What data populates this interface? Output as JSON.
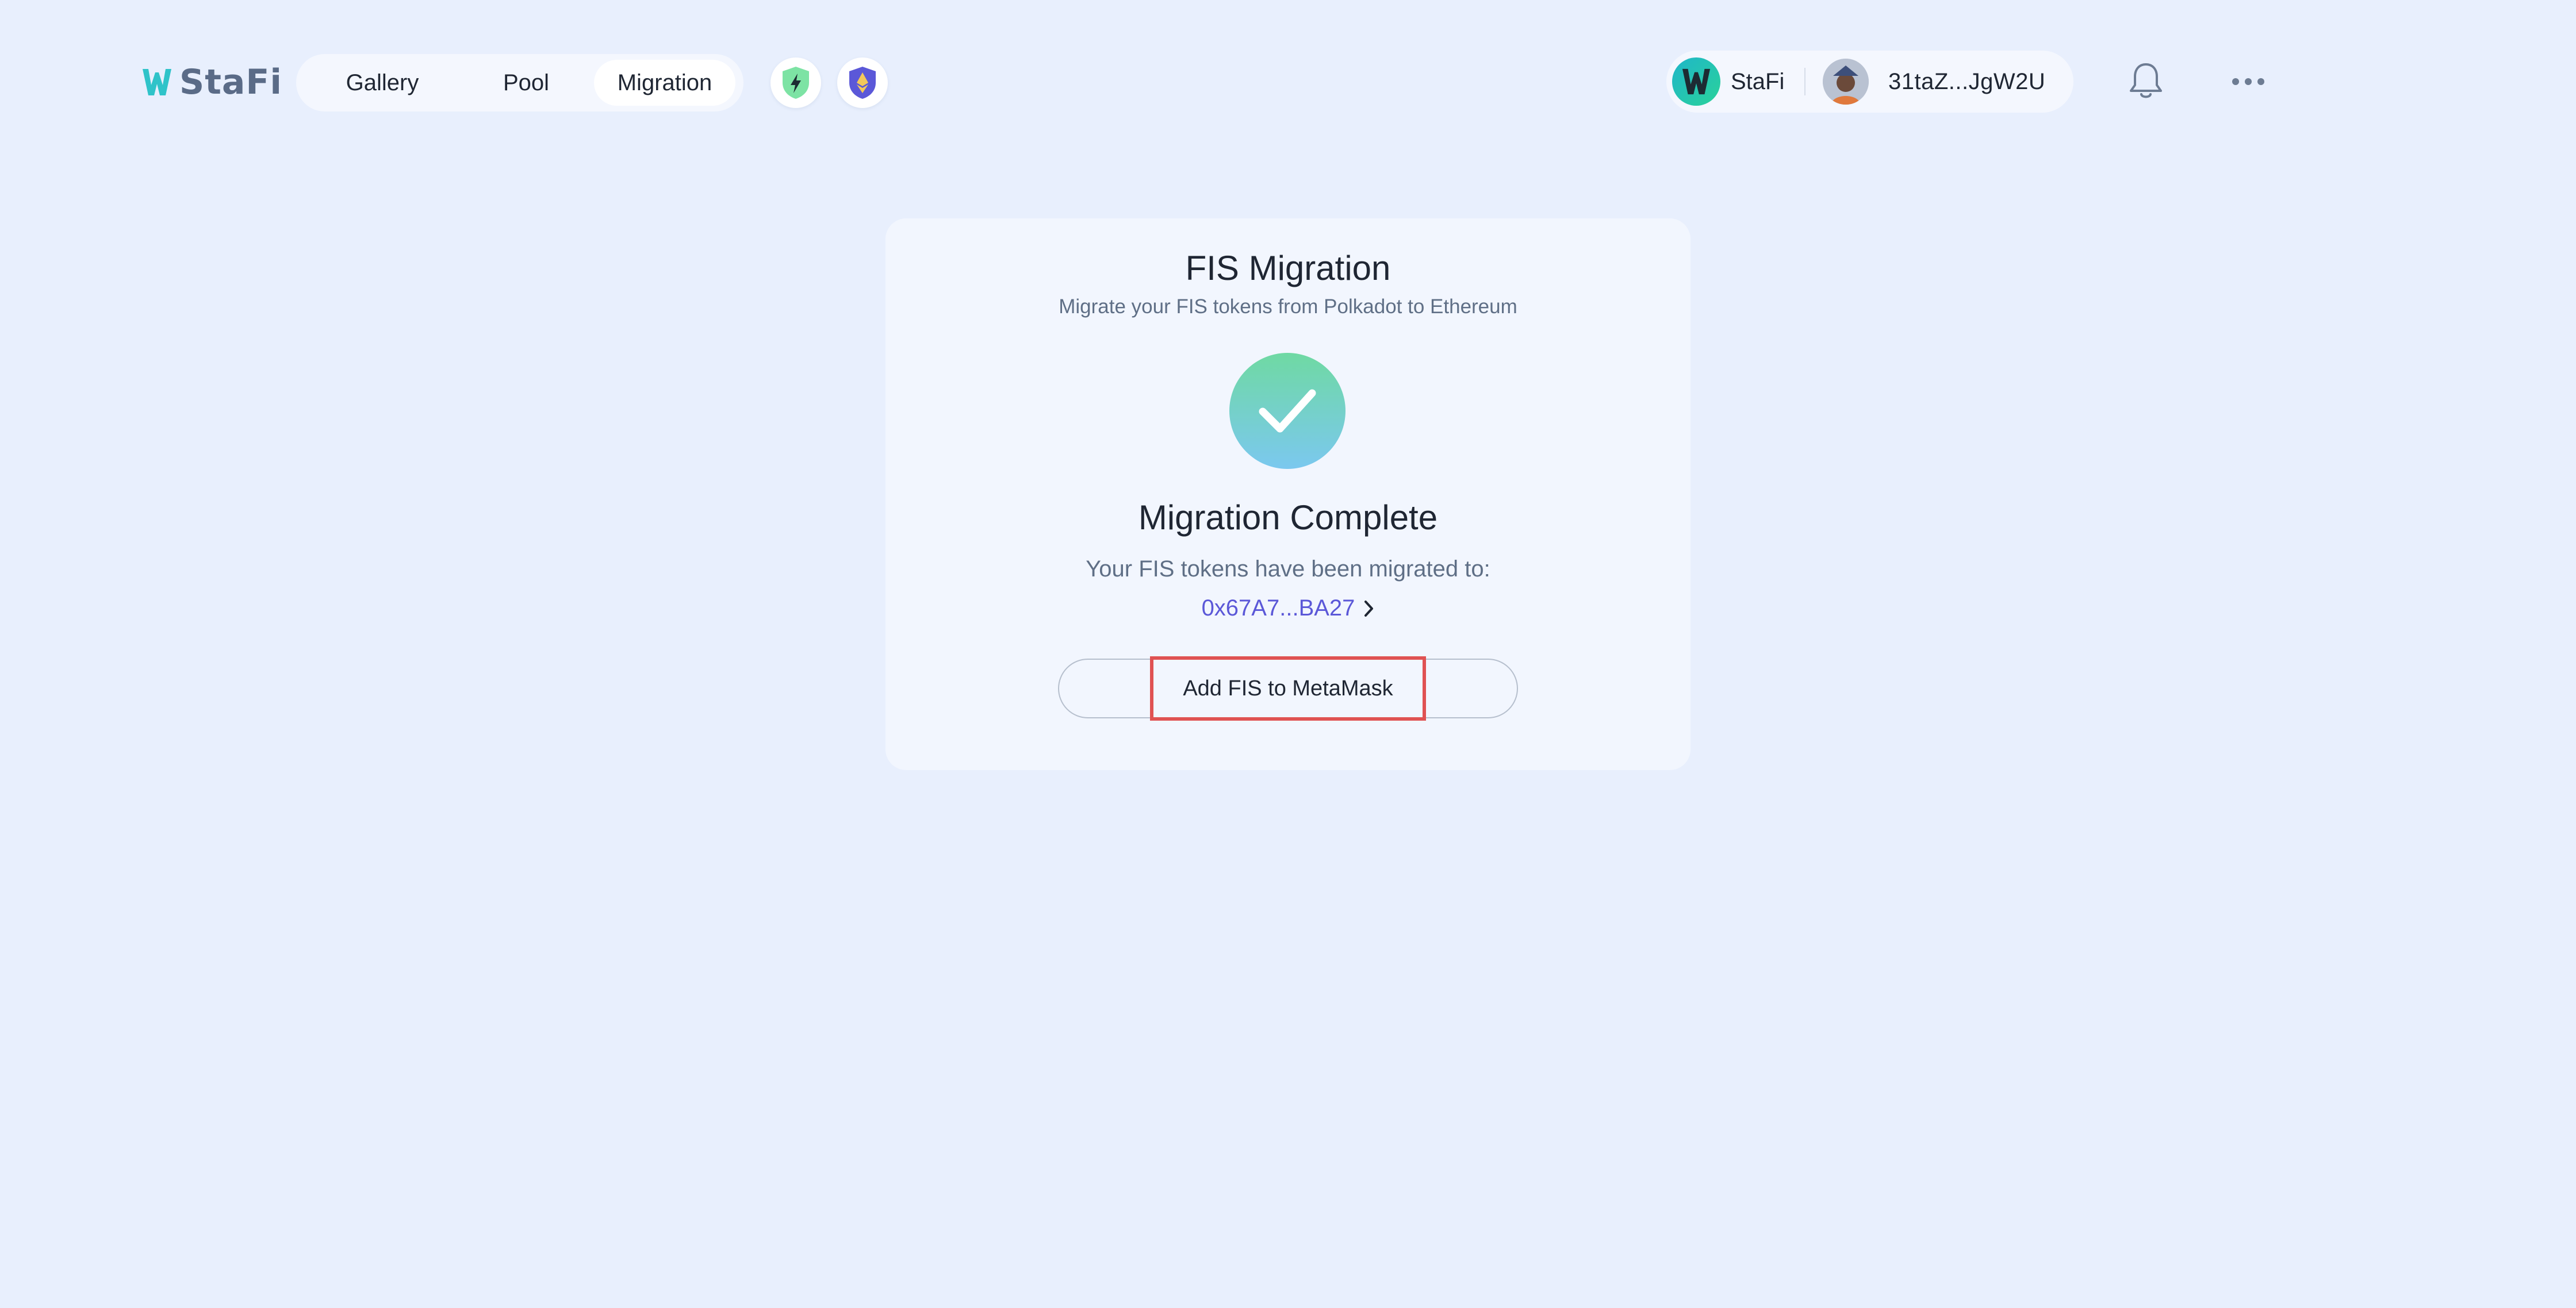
{
  "app": {
    "name": "StaFi",
    "brand_color": "#2fc3c9",
    "accent_color": "#5b58d8"
  },
  "header": {
    "tabs": [
      {
        "label": "Gallery",
        "active": false
      },
      {
        "label": "Pool",
        "active": false
      },
      {
        "label": "Migration",
        "active": true
      }
    ],
    "network_icons": [
      "bolt-shield-icon",
      "ethereum-shield-icon"
    ],
    "account": {
      "network_name": "StaFi",
      "address": "31taZ...JgW2U"
    },
    "icons": [
      "bell-icon",
      "more-icon"
    ]
  },
  "card": {
    "title": "FIS Migration",
    "subtitle": "Migrate your FIS tokens from Polkadot to Ethereum",
    "status_icon": "check-circle-icon",
    "status_title": "Migration Complete",
    "status_description": "Your FIS tokens have been migrated to:",
    "destination_address": "0x67A7...BA27",
    "action_label": "Add FIS to MetaMask"
  }
}
